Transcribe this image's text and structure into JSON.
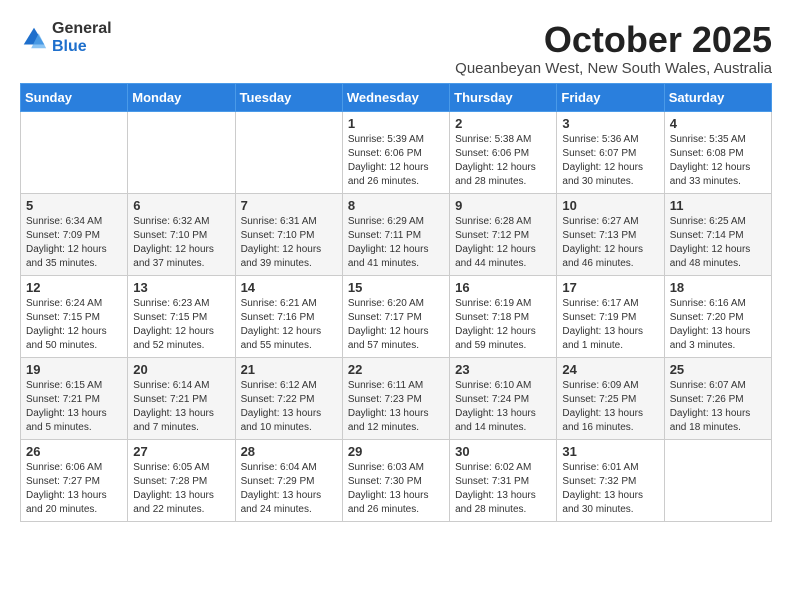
{
  "logo": {
    "general": "General",
    "blue": "Blue"
  },
  "header": {
    "month": "October 2025",
    "location": "Queanbeyan West, New South Wales, Australia"
  },
  "weekdays": [
    "Sunday",
    "Monday",
    "Tuesday",
    "Wednesday",
    "Thursday",
    "Friday",
    "Saturday"
  ],
  "weeks": [
    [
      {
        "day": "",
        "info": ""
      },
      {
        "day": "",
        "info": ""
      },
      {
        "day": "",
        "info": ""
      },
      {
        "day": "1",
        "info": "Sunrise: 5:39 AM\nSunset: 6:06 PM\nDaylight: 12 hours\nand 26 minutes."
      },
      {
        "day": "2",
        "info": "Sunrise: 5:38 AM\nSunset: 6:06 PM\nDaylight: 12 hours\nand 28 minutes."
      },
      {
        "day": "3",
        "info": "Sunrise: 5:36 AM\nSunset: 6:07 PM\nDaylight: 12 hours\nand 30 minutes."
      },
      {
        "day": "4",
        "info": "Sunrise: 5:35 AM\nSunset: 6:08 PM\nDaylight: 12 hours\nand 33 minutes."
      }
    ],
    [
      {
        "day": "5",
        "info": "Sunrise: 6:34 AM\nSunset: 7:09 PM\nDaylight: 12 hours\nand 35 minutes."
      },
      {
        "day": "6",
        "info": "Sunrise: 6:32 AM\nSunset: 7:10 PM\nDaylight: 12 hours\nand 37 minutes."
      },
      {
        "day": "7",
        "info": "Sunrise: 6:31 AM\nSunset: 7:10 PM\nDaylight: 12 hours\nand 39 minutes."
      },
      {
        "day": "8",
        "info": "Sunrise: 6:29 AM\nSunset: 7:11 PM\nDaylight: 12 hours\nand 41 minutes."
      },
      {
        "day": "9",
        "info": "Sunrise: 6:28 AM\nSunset: 7:12 PM\nDaylight: 12 hours\nand 44 minutes."
      },
      {
        "day": "10",
        "info": "Sunrise: 6:27 AM\nSunset: 7:13 PM\nDaylight: 12 hours\nand 46 minutes."
      },
      {
        "day": "11",
        "info": "Sunrise: 6:25 AM\nSunset: 7:14 PM\nDaylight: 12 hours\nand 48 minutes."
      }
    ],
    [
      {
        "day": "12",
        "info": "Sunrise: 6:24 AM\nSunset: 7:15 PM\nDaylight: 12 hours\nand 50 minutes."
      },
      {
        "day": "13",
        "info": "Sunrise: 6:23 AM\nSunset: 7:15 PM\nDaylight: 12 hours\nand 52 minutes."
      },
      {
        "day": "14",
        "info": "Sunrise: 6:21 AM\nSunset: 7:16 PM\nDaylight: 12 hours\nand 55 minutes."
      },
      {
        "day": "15",
        "info": "Sunrise: 6:20 AM\nSunset: 7:17 PM\nDaylight: 12 hours\nand 57 minutes."
      },
      {
        "day": "16",
        "info": "Sunrise: 6:19 AM\nSunset: 7:18 PM\nDaylight: 12 hours\nand 59 minutes."
      },
      {
        "day": "17",
        "info": "Sunrise: 6:17 AM\nSunset: 7:19 PM\nDaylight: 13 hours\nand 1 minute."
      },
      {
        "day": "18",
        "info": "Sunrise: 6:16 AM\nSunset: 7:20 PM\nDaylight: 13 hours\nand 3 minutes."
      }
    ],
    [
      {
        "day": "19",
        "info": "Sunrise: 6:15 AM\nSunset: 7:21 PM\nDaylight: 13 hours\nand 5 minutes."
      },
      {
        "day": "20",
        "info": "Sunrise: 6:14 AM\nSunset: 7:21 PM\nDaylight: 13 hours\nand 7 minutes."
      },
      {
        "day": "21",
        "info": "Sunrise: 6:12 AM\nSunset: 7:22 PM\nDaylight: 13 hours\nand 10 minutes."
      },
      {
        "day": "22",
        "info": "Sunrise: 6:11 AM\nSunset: 7:23 PM\nDaylight: 13 hours\nand 12 minutes."
      },
      {
        "day": "23",
        "info": "Sunrise: 6:10 AM\nSunset: 7:24 PM\nDaylight: 13 hours\nand 14 minutes."
      },
      {
        "day": "24",
        "info": "Sunrise: 6:09 AM\nSunset: 7:25 PM\nDaylight: 13 hours\nand 16 minutes."
      },
      {
        "day": "25",
        "info": "Sunrise: 6:07 AM\nSunset: 7:26 PM\nDaylight: 13 hours\nand 18 minutes."
      }
    ],
    [
      {
        "day": "26",
        "info": "Sunrise: 6:06 AM\nSunset: 7:27 PM\nDaylight: 13 hours\nand 20 minutes."
      },
      {
        "day": "27",
        "info": "Sunrise: 6:05 AM\nSunset: 7:28 PM\nDaylight: 13 hours\nand 22 minutes."
      },
      {
        "day": "28",
        "info": "Sunrise: 6:04 AM\nSunset: 7:29 PM\nDaylight: 13 hours\nand 24 minutes."
      },
      {
        "day": "29",
        "info": "Sunrise: 6:03 AM\nSunset: 7:30 PM\nDaylight: 13 hours\nand 26 minutes."
      },
      {
        "day": "30",
        "info": "Sunrise: 6:02 AM\nSunset: 7:31 PM\nDaylight: 13 hours\nand 28 minutes."
      },
      {
        "day": "31",
        "info": "Sunrise: 6:01 AM\nSunset: 7:32 PM\nDaylight: 13 hours\nand 30 minutes."
      },
      {
        "day": "",
        "info": ""
      }
    ]
  ]
}
